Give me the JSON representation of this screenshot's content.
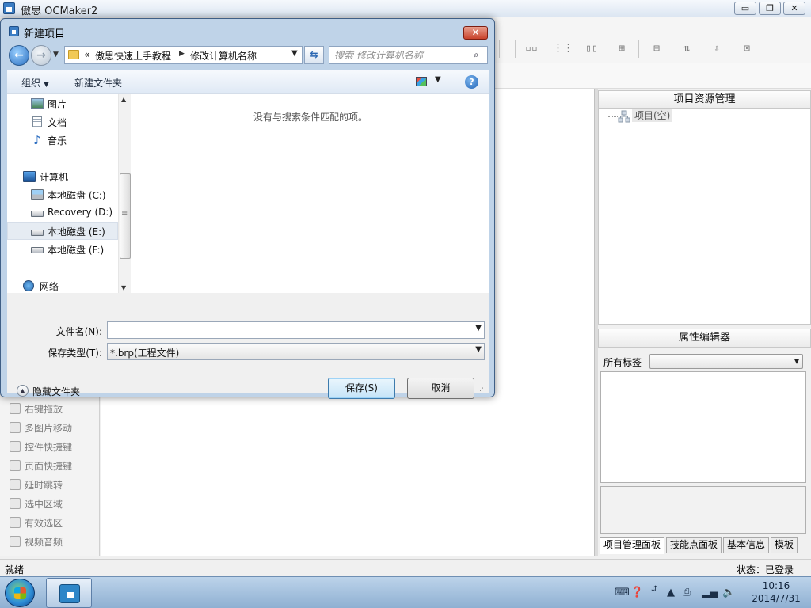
{
  "app": {
    "title": "傲思 OCMaker2",
    "window_buttons": {
      "minimize": "▭",
      "maximize": "❐",
      "close": "✕"
    }
  },
  "left_panel": {
    "items": [
      {
        "label": "右键拖放",
        "icon": "right-drag-icon"
      },
      {
        "label": "多图片移动",
        "icon": "multi-image-icon"
      },
      {
        "label": "控件快捷键",
        "icon": "control-shortcut-icon"
      },
      {
        "label": "页面快捷键",
        "icon": "page-shortcut-icon"
      },
      {
        "label": "延时跳转",
        "icon": "delay-jump-icon"
      },
      {
        "label": "选中区域",
        "icon": "select-region-icon"
      },
      {
        "label": "有效选区",
        "icon": "valid-region-icon"
      },
      {
        "label": "视频音频",
        "icon": "video-audio-icon"
      }
    ]
  },
  "right_panel": {
    "project_title": "项目资源管理",
    "tree_root": "项目(空)",
    "property_title": "属性编辑器",
    "all_tags_label": "所有标签",
    "tabs": [
      "项目管理面板",
      "技能点面板",
      "基本信息",
      "模板"
    ]
  },
  "status": {
    "left": "就绪",
    "right": "状态：已登录"
  },
  "taskbar": {
    "time": "10:16",
    "date": "2014/7/31"
  },
  "dialog": {
    "title": "新建项目",
    "close_label": "✕",
    "breadcrumb": [
      "«",
      "傲思快速上手教程",
      "修改计算机名称"
    ],
    "search_placeholder": "搜索 修改计算机名称",
    "organize_label": "组织",
    "new_folder_label": "新建文件夹",
    "nav_items": [
      {
        "label": "图片",
        "icon": "pictures-icon"
      },
      {
        "label": "文档",
        "icon": "documents-icon"
      },
      {
        "label": "音乐",
        "icon": "music-icon"
      },
      {
        "label": "计算机",
        "icon": "computer-icon"
      },
      {
        "label": "本地磁盘 (C:)",
        "icon": "drive-c-icon"
      },
      {
        "label": "Recovery (D:)",
        "icon": "drive-d-icon"
      },
      {
        "label": "本地磁盘 (E:)",
        "icon": "drive-e-icon",
        "selected": true
      },
      {
        "label": "本地磁盘 (F:)",
        "icon": "drive-f-icon"
      },
      {
        "label": "网络",
        "icon": "network-icon"
      }
    ],
    "empty_message": "没有与搜索条件匹配的项。",
    "filename_label": "文件名(N):",
    "filename_value": "",
    "filetype_label": "保存类型(T):",
    "filetype_value": "*.brp(工程文件)",
    "hide_folders_label": "隐藏文件夹",
    "save_label": "保存(S)",
    "cancel_label": "取消"
  }
}
